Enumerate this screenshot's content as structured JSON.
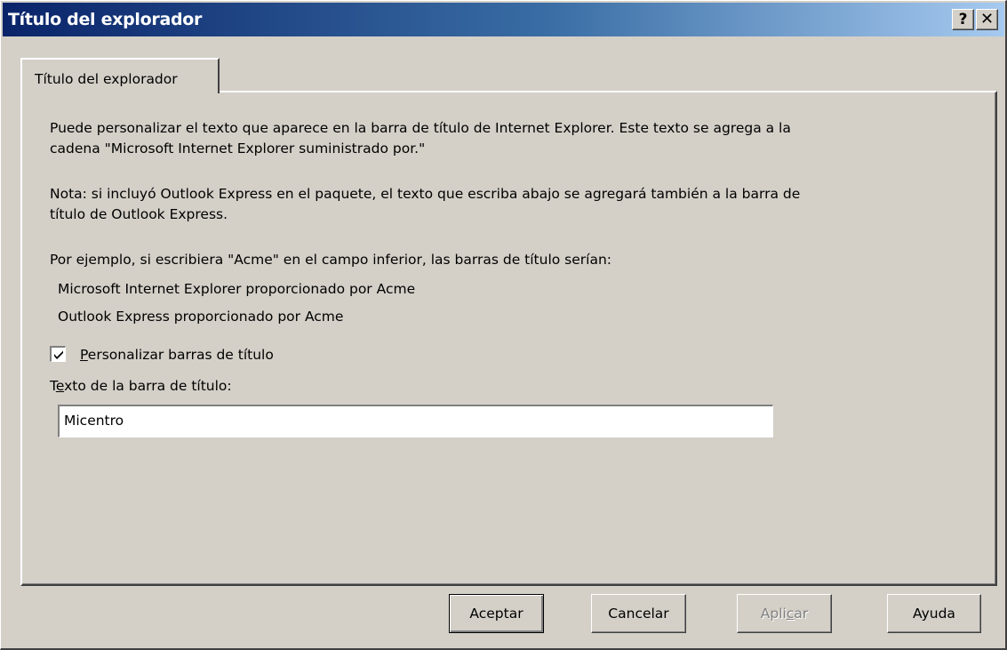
{
  "window": {
    "title": "Título del explorador",
    "help_glyph": "?",
    "close_glyph": "✕"
  },
  "tab": {
    "label": "Título del explorador"
  },
  "panel": {
    "intro_line1": "Puede personalizar el texto que aparece en la barra de título de Internet Explorer. Este texto se agrega a la",
    "intro_line2": "cadena \"Microsoft Internet Explorer suministrado por.\"",
    "note_line1": "Nota: si incluyó Outlook Express en el paquete, el texto que escriba abajo se agregará también a la barra de",
    "note_line2": "título de Outlook Express.",
    "example_intro": "Por ejemplo, si escribiera \"Acme\" en el campo inferior, las barras de título serían:",
    "example1": "Microsoft Internet Explorer proporcionado por Acme",
    "example2": "Outlook Express proporcionado por Acme",
    "checkbox": {
      "checked": true,
      "label_first": "P",
      "label_rest": "ersonalizar barras de título"
    },
    "field_label_a": "T",
    "field_label_b": "e",
    "field_label_c": "xto de la barra de título:",
    "field_value": "Micentro"
  },
  "buttons": {
    "ok": "Aceptar",
    "cancel": "Cancelar",
    "apply_a": "Apli",
    "apply_b": "c",
    "apply_c": "ar",
    "help": "Ayuda"
  }
}
